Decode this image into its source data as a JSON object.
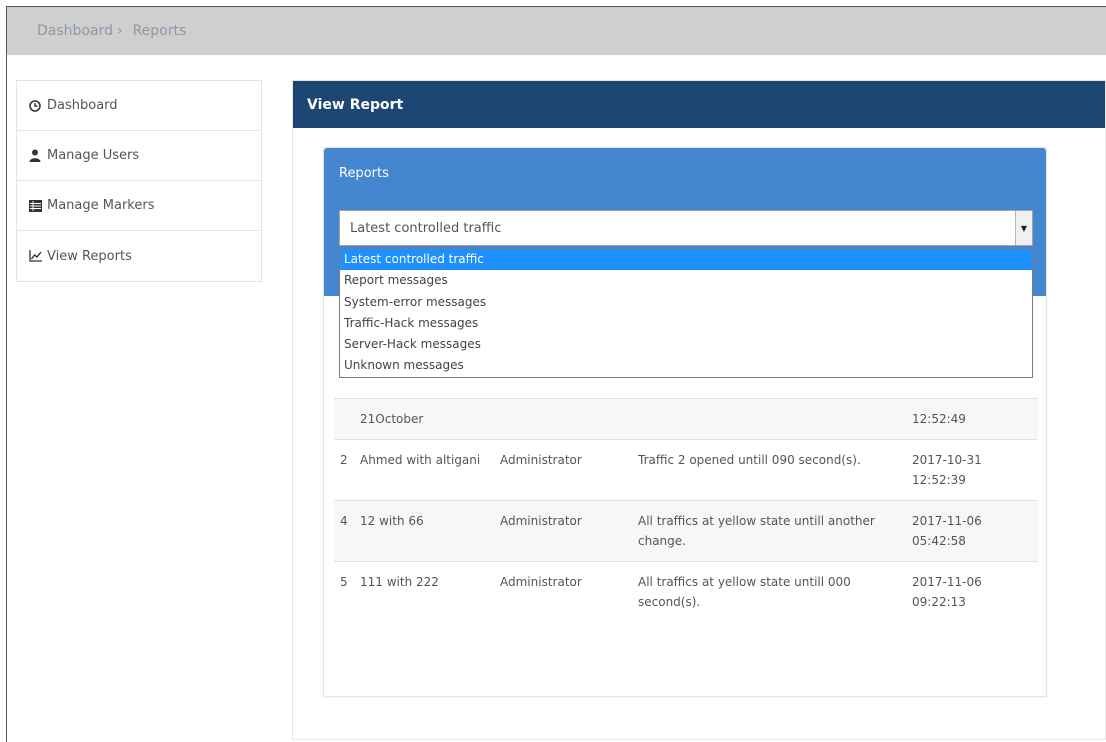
{
  "breadcrumb": {
    "items": [
      "Dashboard",
      "Reports"
    ],
    "separator": "›"
  },
  "sidebar": {
    "items": [
      {
        "label": "Dashboard",
        "icon": "clock-icon"
      },
      {
        "label": "Manage Users",
        "icon": "user-icon"
      },
      {
        "label": "Manage Markers",
        "icon": "list-icon"
      },
      {
        "label": "View Reports",
        "icon": "line-chart-icon"
      }
    ]
  },
  "panel": {
    "title": "View Report"
  },
  "reports": {
    "title": "Reports",
    "select": {
      "value": "Latest controlled traffic",
      "options": [
        "Latest controlled traffic",
        "Report messages",
        "System-error messages",
        "Traffic-Hack messages",
        "Server-Hack messages",
        "Unknown messages"
      ],
      "selected_index": 0
    }
  },
  "table": {
    "rows": [
      {
        "id": "",
        "name": "21October",
        "user": "",
        "message": "",
        "date": "",
        "time": "12:52:49"
      },
      {
        "id": "2",
        "name": "Ahmed with altigani",
        "user": "Administrator",
        "message": "Traffic 2 opened untill 090 second(s).",
        "date": "2017-10-31",
        "time": "12:52:39"
      },
      {
        "id": "4",
        "name": "12 with 66",
        "user": "Administrator",
        "message": "All traffics at yellow state untill another change.",
        "date": "2017-11-06",
        "time": "05:42:58"
      },
      {
        "id": "5",
        "name": "111 with 222",
        "user": "Administrator",
        "message": "All traffics at yellow state untill 000 second(s).",
        "date": "2017-11-06",
        "time": "09:22:13"
      }
    ]
  },
  "colors": {
    "panel_heading": "#1d4672",
    "reports_head": "#4486cf",
    "selected_option": "#1e90ff",
    "breadcrumb_bar": "#cfcfcf"
  }
}
